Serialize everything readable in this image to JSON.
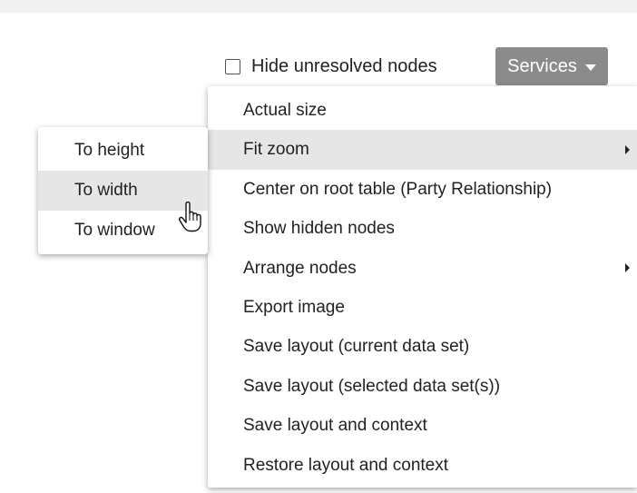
{
  "toolbar": {
    "hide_unresolved_label": "Hide unresolved nodes",
    "hide_unresolved_checked": false,
    "services_label": "Services"
  },
  "main_menu": {
    "items": [
      {
        "label": "Actual size",
        "has_submenu": false
      },
      {
        "label": "Fit zoom",
        "has_submenu": true,
        "highlighted": true
      },
      {
        "label": "Center on root table (Party Relationship)",
        "has_submenu": false
      },
      {
        "label": "Show hidden nodes",
        "has_submenu": false
      },
      {
        "label": "Arrange nodes",
        "has_submenu": true
      },
      {
        "label": "Export image",
        "has_submenu": false
      },
      {
        "label": "Save layout (current data set)",
        "has_submenu": false
      },
      {
        "label": "Save layout (selected data set(s))",
        "has_submenu": false
      },
      {
        "label": "Save layout and context",
        "has_submenu": false
      },
      {
        "label": "Restore layout and context",
        "has_submenu": false
      }
    ]
  },
  "fit_zoom_submenu": {
    "items": [
      {
        "label": "To height"
      },
      {
        "label": "To width",
        "highlighted": true
      },
      {
        "label": "To window"
      }
    ]
  },
  "colors": {
    "services_button_bg": "#8b8b8b",
    "highlight_bg": "#e6e6e6",
    "top_strip": "#f1f1f1"
  },
  "icons": {
    "submenu_indicator": "caret-right-icon",
    "dropdown_indicator": "caret-down-icon",
    "cursor": "hand-pointer-icon"
  }
}
